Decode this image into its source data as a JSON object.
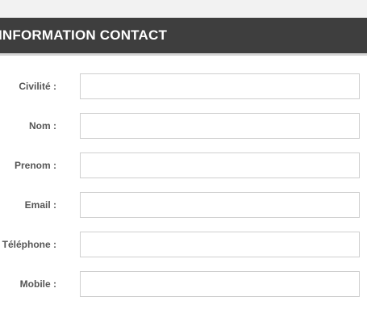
{
  "header": {
    "title": "INFORMATION CONTACT"
  },
  "form": {
    "fields": [
      {
        "label": "Civilité :",
        "value": "",
        "placeholder": ""
      },
      {
        "label": "Nom :",
        "value": "",
        "placeholder": ""
      },
      {
        "label": "Prenom :",
        "value": "",
        "placeholder": ""
      },
      {
        "label": "Email :",
        "value": "",
        "placeholder": ""
      },
      {
        "label": "Téléphone :",
        "value": "",
        "placeholder": ""
      },
      {
        "label": "Mobile :",
        "value": "",
        "placeholder": ""
      }
    ]
  },
  "colors": {
    "header_bg": "#3e3e3e",
    "header_text": "#ffffff",
    "label_text": "#555555",
    "input_border": "#cfcfcf"
  }
}
